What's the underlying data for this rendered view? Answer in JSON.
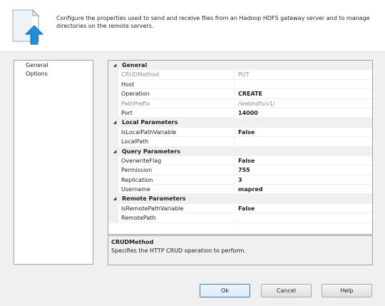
{
  "header": {
    "description": "Configure the properties used to send and receive files from an Hadoop HDFS gateway server and to manage directories on the remote servers."
  },
  "nav": {
    "items": [
      {
        "label": "General"
      },
      {
        "label": "Options"
      }
    ]
  },
  "grid": {
    "categories": [
      {
        "label": "General",
        "properties": [
          {
            "name": "CRUDMethod",
            "value": "PUT",
            "readonly": true
          },
          {
            "name": "Host",
            "value": ""
          },
          {
            "name": "Operation",
            "value": "CREATE"
          },
          {
            "name": "PathPrefix",
            "value": "/webhdfs/v1/",
            "readonly": true
          },
          {
            "name": "Port",
            "value": "14000"
          }
        ]
      },
      {
        "label": "Local Parameters",
        "properties": [
          {
            "name": "IsLocalPathVariable",
            "value": "False"
          },
          {
            "name": "LocalPath",
            "value": ""
          }
        ]
      },
      {
        "label": "Query Parameters",
        "properties": [
          {
            "name": "OverwriteFlag",
            "value": "False"
          },
          {
            "name": "Permission",
            "value": "755"
          },
          {
            "name": "Replication",
            "value": "3"
          },
          {
            "name": "Username",
            "value": "mapred"
          }
        ]
      },
      {
        "label": "Remote Parameters",
        "properties": [
          {
            "name": "IsRemotePathVariable",
            "value": "False"
          },
          {
            "name": "RemotePath",
            "value": ""
          }
        ]
      }
    ]
  },
  "description_panel": {
    "title": "CRUDMethod",
    "text": "Specifies the HTTP CRUD operation to perform."
  },
  "buttons": {
    "ok": "Ok",
    "cancel": "Cancel",
    "help": "Help"
  },
  "icons": {
    "header": "document-upload-icon",
    "expander": "collapse-triangle-icon"
  },
  "colors": {
    "background": "#f0f0f0",
    "accent": "#1e8fd8",
    "readonly_text": "#8a8a8a",
    "category_band": "#f0f0f0"
  }
}
